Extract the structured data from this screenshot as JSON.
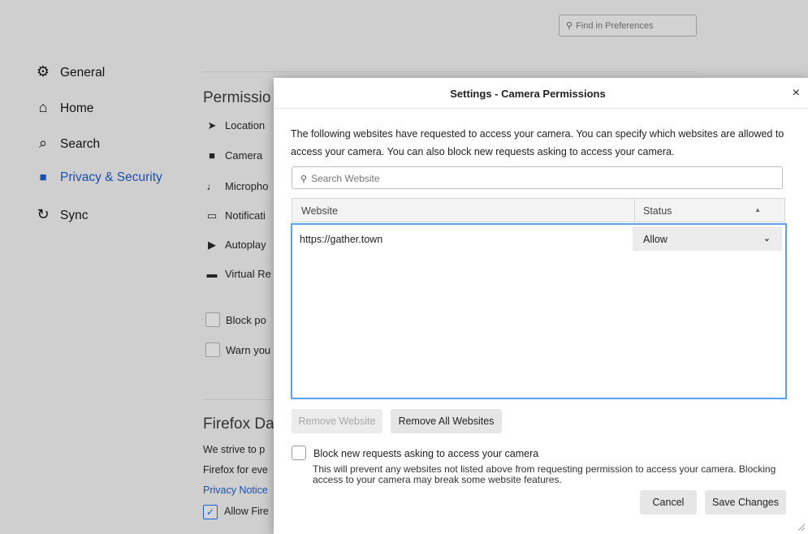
{
  "background": {
    "find_placeholder": "Find in Preferences",
    "nav": [
      {
        "label": "General",
        "icon": "gear-icon",
        "glyph": "⚙",
        "active": false
      },
      {
        "label": "Home",
        "icon": "home-icon",
        "glyph": "⌂",
        "active": false
      },
      {
        "label": "Search",
        "icon": "search-icon",
        "glyph": "⌕",
        "active": false
      },
      {
        "label": "Privacy & Security",
        "icon": "lock-icon",
        "glyph": "🔒",
        "active": true
      },
      {
        "label": "Sync",
        "icon": "sync-icon",
        "glyph": "↻",
        "active": false
      }
    ],
    "permissions_title": "Permissio",
    "permissions": [
      {
        "label": "Location",
        "icon": "location-arrow-icon",
        "glyph": "➤"
      },
      {
        "label": "Camera",
        "icon": "camera-icon",
        "glyph": "■"
      },
      {
        "label": "Micropho",
        "icon": "microphone-icon",
        "glyph": "♩"
      },
      {
        "label": "Notificati",
        "icon": "notification-icon",
        "glyph": "▭"
      },
      {
        "label": "Autoplay",
        "icon": "autoplay-icon",
        "glyph": "▶"
      },
      {
        "label": "Virtual Re",
        "icon": "vr-headset-icon",
        "glyph": "▬"
      }
    ],
    "checkbox_labels": [
      "Block po",
      "Warn you"
    ],
    "firefox_data_title": "Firefox Da",
    "firefox_text_1": "We strive to p",
    "firefox_text_2": "Firefox for eve",
    "privacy_link": "Privacy Notice",
    "allow_label": "Allow Fire"
  },
  "dialog": {
    "title": "Settings - Camera Permissions",
    "close_glyph": "×",
    "description": "The following websites have requested to access your camera. You can specify which websites are allowed to access your camera. You can also block new requests asking to access your camera.",
    "search_placeholder": "Search Website",
    "columns": {
      "website": "Website",
      "status": "Status"
    },
    "rows": [
      {
        "website": "https://gather.town",
        "status": "Allow"
      }
    ],
    "remove_website": "Remove Website",
    "remove_all": "Remove All Websites",
    "block_label": "Block new requests asking to access your camera",
    "block_note": "This will prevent any websites not listed above from requesting permission to access your camera. Blocking access to your camera may break some website features.",
    "cancel": "Cancel",
    "save": "Save Changes"
  }
}
